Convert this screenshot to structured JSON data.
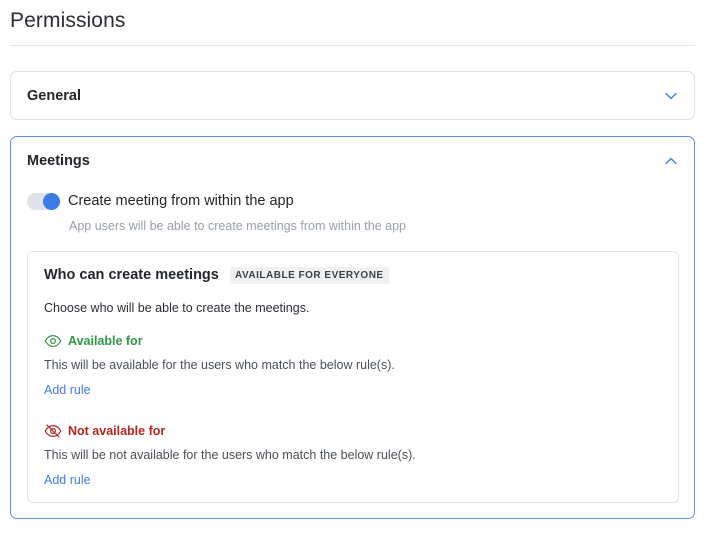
{
  "page": {
    "title": "Permissions"
  },
  "panels": {
    "general": {
      "label": "General",
      "state": "collapsed",
      "chevron_icon": "chevron-down-icon"
    },
    "meetings": {
      "label": "Meetings",
      "state": "expanded",
      "chevron_icon": "chevron-up-icon",
      "toggle": {
        "label": "Create meeting from within the app",
        "help": "App users will be able to create meetings from within the app",
        "on": true
      },
      "rule_card": {
        "title": "Who can create meetings",
        "badge": "AVAILABLE FOR EVERYONE",
        "description": "Choose who will be able to create the meetings.",
        "available": {
          "heading": "Available for",
          "icon": "eye-icon",
          "description": "This will be available for the users who match the below rule(s).",
          "add_rule": "Add rule"
        },
        "not_available": {
          "heading": "Not available for",
          "icon": "eye-off-icon",
          "description": "This will be not available for the users who match the below rule(s).",
          "add_rule": "Add rule"
        }
      }
    }
  },
  "colors": {
    "accent": "#3d7ce8",
    "available": "#2f9a44",
    "not_available": "#b3261e",
    "expanded_border": "#5b8fe0"
  }
}
